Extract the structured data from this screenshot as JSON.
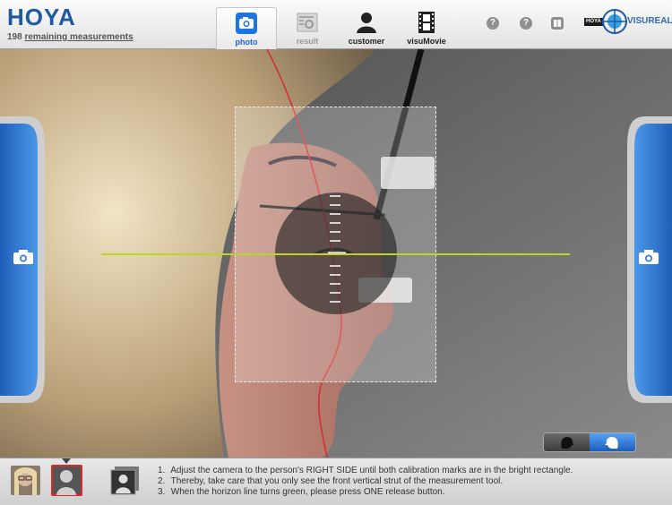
{
  "header": {
    "logo": "HOYA",
    "remaining_count": "198",
    "remaining_label": "remaining measurements",
    "tabs": [
      {
        "label": "photo",
        "icon": "camera-icon",
        "state": "active"
      },
      {
        "label": "result",
        "icon": "result-icon",
        "state": "disabled"
      },
      {
        "label": "customer",
        "icon": "customer-icon",
        "state": "normal"
      },
      {
        "label": "visuMovie",
        "icon": "film-icon",
        "state": "normal"
      }
    ],
    "help_buttons": [
      "?",
      "?"
    ],
    "brand_badge": "HOYA",
    "brand": "VISUREAL"
  },
  "colors": {
    "accent_blue": "#1e62c8",
    "horizon_line": "#b8d62a",
    "guide_line": "#d62b2b",
    "side_button": "#2f7fd8"
  },
  "instructions": [
    {
      "num": "1.",
      "text": "Adjust the camera to the person's RIGHT SIDE until both calibration marks are in the bright rectangle."
    },
    {
      "num": "2.",
      "text": "Thereby, take care that you only see the front vertical strut of the measurement tool."
    },
    {
      "num": "3.",
      "text": "When the horizon line turns green, please press ONE release button."
    }
  ]
}
